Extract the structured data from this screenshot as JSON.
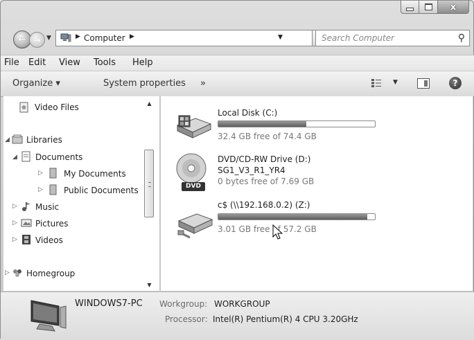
{
  "window": {
    "close_glyph": "x"
  },
  "nav": {
    "address_crumbs": [
      "Computer"
    ],
    "search_placeholder": "Search Computer"
  },
  "menu": [
    "File",
    "Edit",
    "View",
    "Tools",
    "Help"
  ],
  "command_bar": {
    "organize": "Organize ▾",
    "system_properties": "System properties",
    "more": "»"
  },
  "sidebar": {
    "items": [
      {
        "label": "Video Files",
        "icon": "video-file-icon"
      },
      {
        "label": "Libraries",
        "icon": "libraries-icon"
      },
      {
        "label": "Documents",
        "icon": "documents-icon"
      },
      {
        "label": "My Documents",
        "icon": "folder-icon"
      },
      {
        "label": "Public Documents",
        "icon": "folder-icon"
      },
      {
        "label": "Music",
        "icon": "music-icon"
      },
      {
        "label": "Pictures",
        "icon": "pictures-icon"
      },
      {
        "label": "Videos",
        "icon": "videos-icon"
      },
      {
        "label": "Homegroup",
        "icon": "homegroup-icon"
      }
    ]
  },
  "drives": [
    {
      "name": "Local Disk (C:)",
      "free": "32.4 GB free of 74.4 GB",
      "used_fraction": 0.56,
      "icon": "hard-disk-icon"
    },
    {
      "name": "DVD/CD-RW Drive (D:)",
      "label": "SG1_V3_R1_YR4",
      "free": "0 bytes free of 7.69 GB",
      "icon": "dvd-drive-icon",
      "badge": "DVD"
    },
    {
      "name": "c$ (\\\\192.168.0.2) (Z:)",
      "free": "3.01 GB free of 57.2 GB",
      "used_fraction": 0.95,
      "icon": "network-drive-icon"
    }
  ],
  "details": {
    "computer_name": "WINDOWS7-PC",
    "workgroup_label": "Workgroup:",
    "workgroup_value": "WORKGROUP",
    "processor_label": "Processor:",
    "processor_value": "Intel(R) Pentium(R) 4 CPU 3.20GHz"
  },
  "colors": {
    "bar_fill": "#6d6d6d",
    "window_bg": "#d6d6d6"
  }
}
